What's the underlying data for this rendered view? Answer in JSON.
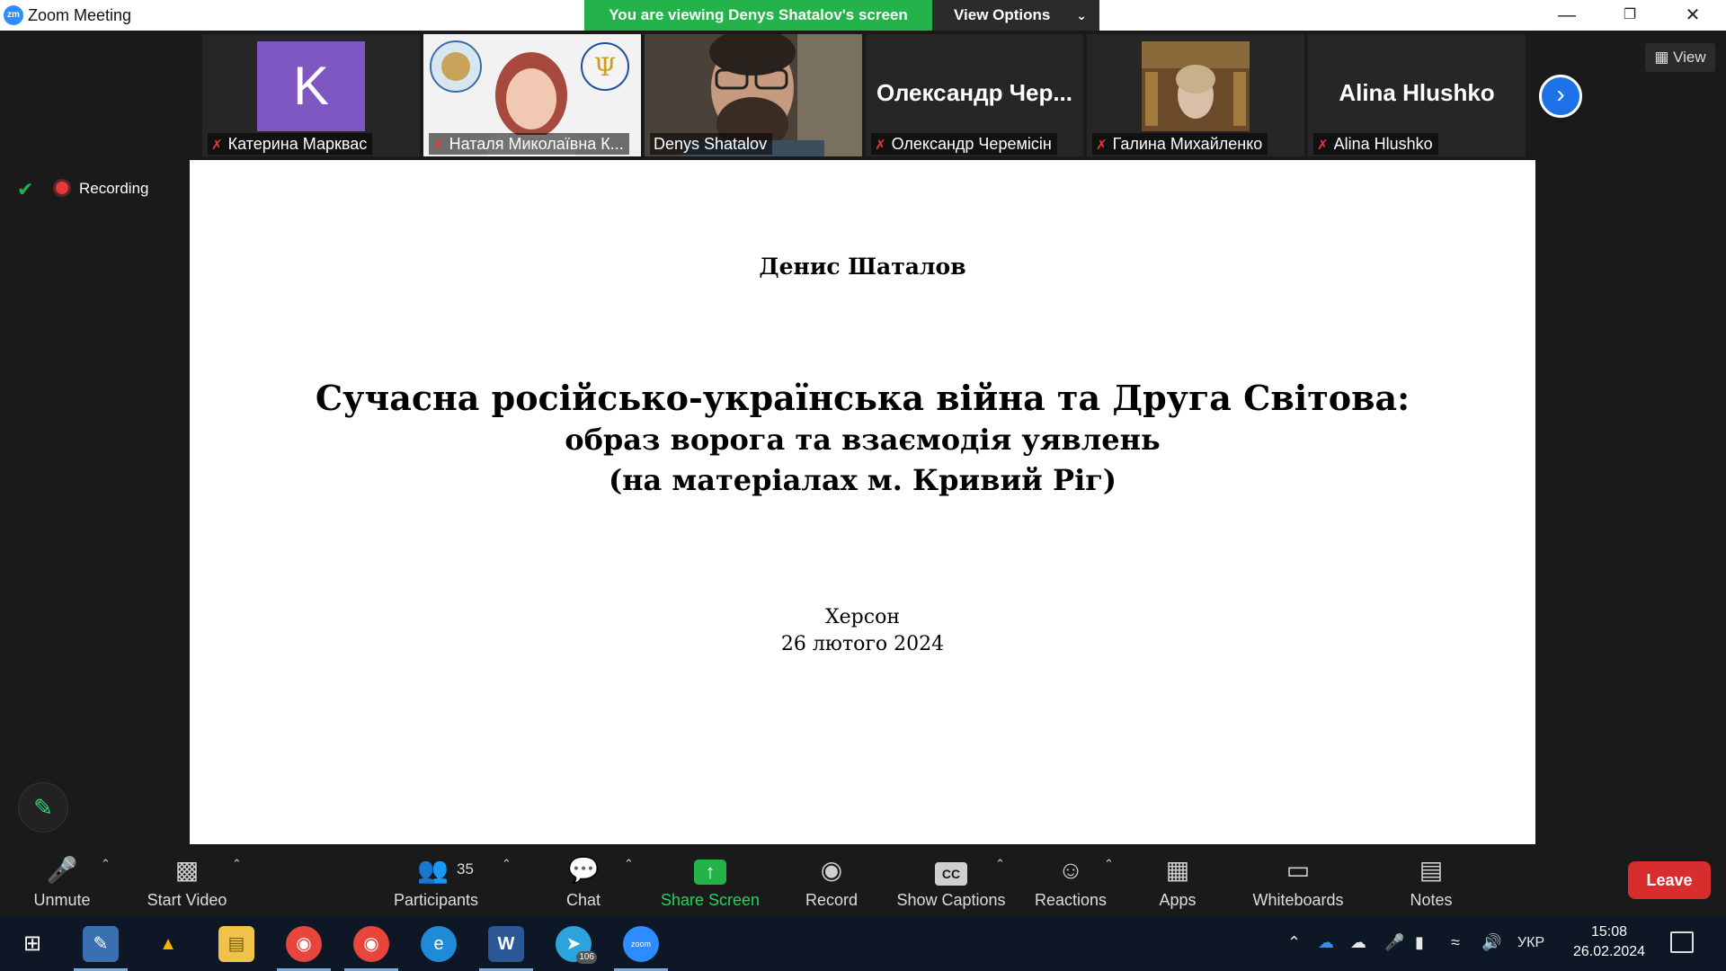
{
  "window": {
    "title": "Zoom Meeting",
    "logo_text": "zm",
    "viewing_banner": "You are viewing Denys Shatalov's screen",
    "view_options": "View Options"
  },
  "participants": [
    {
      "name": "Катерина Марквас",
      "muted": true,
      "avatar_letter": "K",
      "avatar_color": "#7e57c2"
    },
    {
      "name": "Наталя Миколаївна К...",
      "muted": true
    },
    {
      "name": "Denys Shatalov",
      "muted": false,
      "active_speaker": true
    },
    {
      "name": "Олександр Черемісін",
      "muted": true,
      "display_name": "Олександр Чер..."
    },
    {
      "name": "Галина Михайленко",
      "muted": true
    },
    {
      "name": "Alina Hlushko",
      "muted": true,
      "display_name": "Alina Hlushko"
    }
  ],
  "view_button": "View",
  "recording_label": "Recording",
  "slide": {
    "author": "Денис Шаталов",
    "title_line1": "Сучасна російсько-українська війна та Друга Світова:",
    "title_line2": "образ ворога та взаємодія уявлень",
    "title_line3": "(на матеріалах м. Кривий Ріг)",
    "city": "Херсон",
    "date": "26 лютого 2024"
  },
  "toolbar": {
    "unmute": "Unmute",
    "start_video": "Start Video",
    "participants": "Participants",
    "participants_count": "35",
    "chat": "Chat",
    "share_screen": "Share Screen",
    "record": "Record",
    "show_captions": "Show Captions",
    "reactions": "Reactions",
    "apps": "Apps",
    "whiteboards": "Whiteboards",
    "notes": "Notes",
    "leave": "Leave"
  },
  "taskbar": {
    "telegram_badge": "106",
    "zoom_label": "zoom",
    "language": "УКР",
    "time": "15:08",
    "date": "26.02.2024"
  },
  "colors": {
    "accent_green": "#24b24a",
    "leave_red": "#d82d2d",
    "zoom_blue": "#2d8cff",
    "muted_red": "#e5383b"
  }
}
